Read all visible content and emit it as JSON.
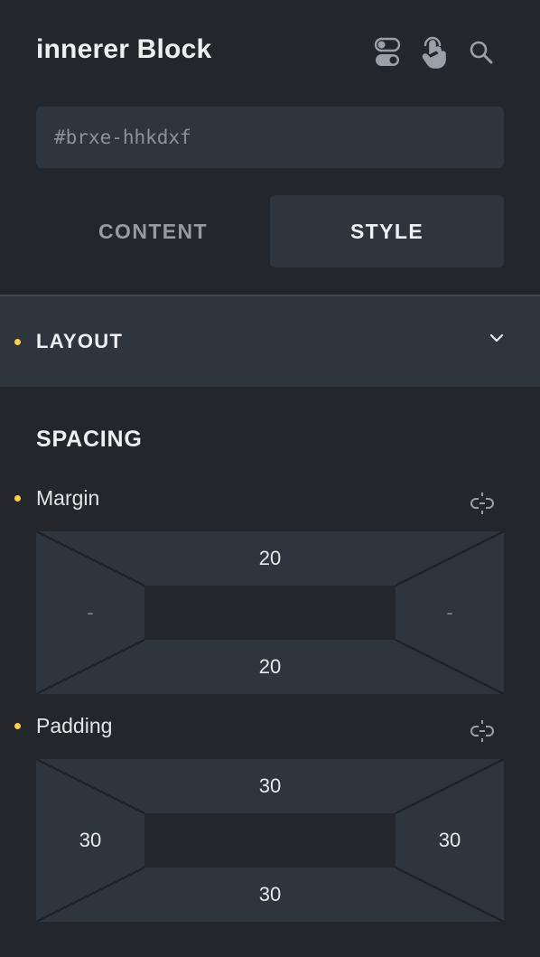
{
  "header": {
    "title": "innerer Block",
    "icons": [
      "toggle-icon",
      "pointer-hand-icon",
      "search-icon"
    ]
  },
  "id_field": {
    "placeholder": "#brxe-hhkdxf"
  },
  "tabs": [
    {
      "label": "CONTENT",
      "active": false
    },
    {
      "label": "STYLE",
      "active": true
    }
  ],
  "layout_section": {
    "label": "LAYOUT",
    "has_value_indicator": true
  },
  "spacing": {
    "title": "SPACING",
    "margin": {
      "label": "Margin",
      "top": "20",
      "right": "-",
      "bottom": "20",
      "left": "-"
    },
    "padding": {
      "label": "Padding",
      "top": "30",
      "right": "30",
      "bottom": "30",
      "left": "30"
    }
  },
  "colors": {
    "background": "#23272c",
    "surface": "#2f353c",
    "indicator": "#ffcf47",
    "text": "#eef0f2",
    "muted": "#959ba1"
  }
}
